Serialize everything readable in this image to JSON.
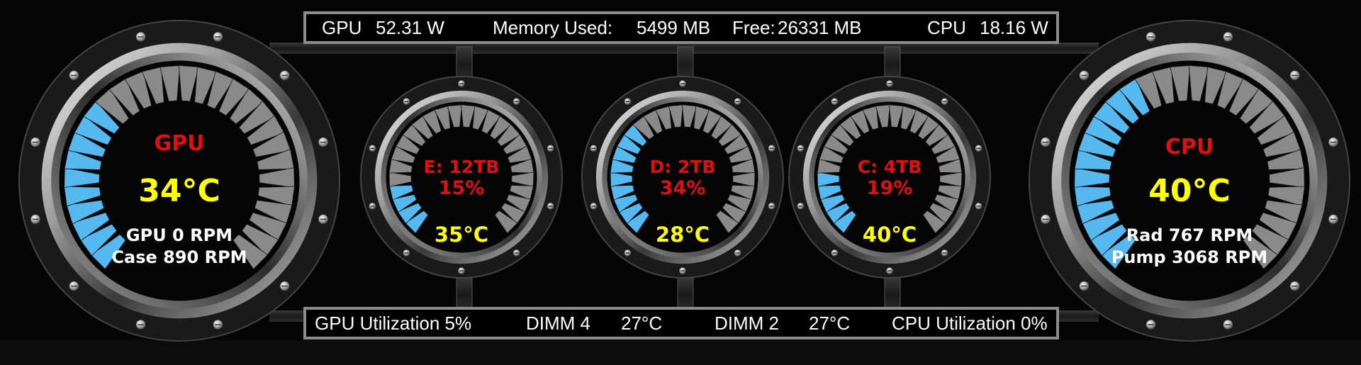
{
  "top_bar": {
    "gpu_label": "GPU",
    "gpu_power": "52.31 W",
    "memory_used_label": "Memory Used:",
    "memory_used": "5499 MB",
    "free_label": "Free:",
    "free": "26331 MB",
    "cpu_label": "CPU",
    "cpu_power": "18.16 W"
  },
  "bottom_bar": {
    "gpu_util": "GPU Utilization 5%",
    "dimm4_label": "DIMM 4",
    "dimm4_temp": "27°C",
    "dimm2_label": "DIMM 2",
    "dimm2_temp": "27°C",
    "cpu_util": "CPU Utilization 0%"
  },
  "gauges": {
    "gpu": {
      "title": "GPU",
      "temp": "34°C",
      "line1": "GPU 0 RPM",
      "line2": "Case 890 RPM",
      "level": 0.34
    },
    "drive_e": {
      "title": "E: 12TB",
      "usage": "15%",
      "temp": "35°C",
      "level": 0.15
    },
    "drive_d": {
      "title": "D: 2TB",
      "usage": "34%",
      "temp": "28°C",
      "level": 0.34
    },
    "drive_c": {
      "title": "C: 4TB",
      "usage": "19%",
      "temp": "40°C",
      "level": 0.19
    },
    "cpu": {
      "title": "CPU",
      "temp": "40°C",
      "line1": "Rad 767 RPM",
      "line2": "Pump 3068 RPM",
      "level": 0.4
    }
  },
  "colors": {
    "fin_active": "#55b8ee",
    "fin_inactive": "#8a8a8a",
    "title_red": "#e01010",
    "temp_yellow": "#ffff00"
  }
}
